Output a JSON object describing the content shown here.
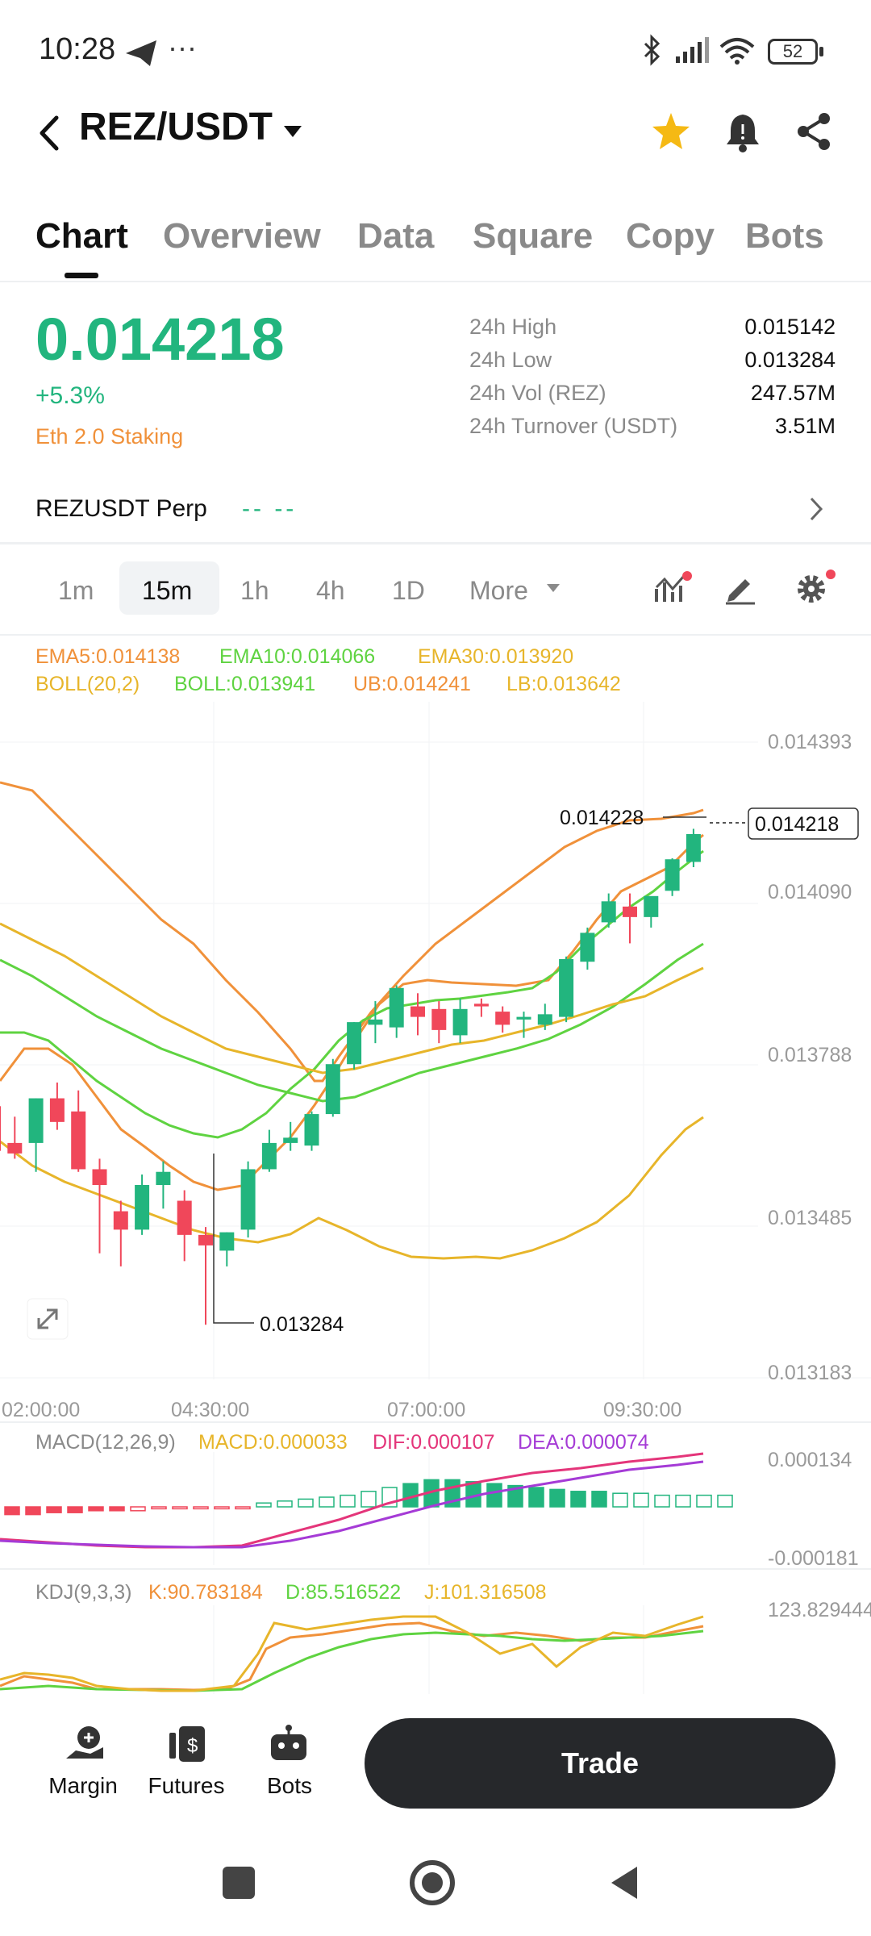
{
  "status": {
    "time": "10:28",
    "battery": "52"
  },
  "header": {
    "pair": "REZ/USDT"
  },
  "tabs": [
    {
      "label": "Chart"
    },
    {
      "label": "Overview"
    },
    {
      "label": "Data"
    },
    {
      "label": "Square"
    },
    {
      "label": "Copy"
    },
    {
      "label": "Bots"
    }
  ],
  "ticker": {
    "last_price": "0.014218",
    "change_pct": "+5.3%",
    "tag": "Eth 2.0 Staking",
    "stats": [
      {
        "label": "24h High",
        "value": "0.015142"
      },
      {
        "label": "24h Low",
        "value": "0.013284"
      },
      {
        "label": "24h Vol (REZ)",
        "value": "247.57M"
      },
      {
        "label": "24h Turnover (USDT)",
        "value": "3.51M"
      }
    ]
  },
  "perp": {
    "label": "REZUSDT Perp",
    "value": "-- --"
  },
  "intervals": [
    {
      "label": "1m"
    },
    {
      "label": "15m"
    },
    {
      "label": "1h"
    },
    {
      "label": "4h"
    },
    {
      "label": "1D"
    },
    {
      "label": "More"
    }
  ],
  "indicators": {
    "ema5": "EMA5:0.014138",
    "ema10": "EMA10:0.014066",
    "ema30": "EMA30:0.013920",
    "boll_name": "BOLL(20,2)",
    "boll": "BOLL:0.013941",
    "ub": "UB:0.014241",
    "lb": "LB:0.013642"
  },
  "colors": {
    "up": "#22b57e",
    "down": "#f0475a",
    "ema5": "#f0913a",
    "ema10": "#5fd341",
    "ema30": "#e7b52a"
  },
  "chart_data": {
    "type": "candlestick",
    "y_ticks": [
      "0.014393",
      "0.014090",
      "0.013788",
      "0.013485",
      "0.013183"
    ],
    "x_ticks": [
      "02:00:00",
      "04:30:00",
      "07:00:00",
      "09:30:00"
    ],
    "current_price_label": "0.014218",
    "high_marker": "0.014228",
    "low_marker": "0.013284",
    "candles": [
      {
        "o": 0.0137,
        "h": 0.013735,
        "l": 0.013595,
        "c": 0.013615
      },
      {
        "o": 0.01363,
        "h": 0.01368,
        "l": 0.0136,
        "c": 0.01361
      },
      {
        "o": 0.01363,
        "h": 0.013715,
        "l": 0.013575,
        "c": 0.013715
      },
      {
        "o": 0.013715,
        "h": 0.013745,
        "l": 0.013655,
        "c": 0.01367
      },
      {
        "o": 0.01369,
        "h": 0.01373,
        "l": 0.013575,
        "c": 0.01358
      },
      {
        "o": 0.01358,
        "h": 0.0136,
        "l": 0.01342,
        "c": 0.01355
      },
      {
        "o": 0.0135,
        "h": 0.01352,
        "l": 0.013395,
        "c": 0.013465
      },
      {
        "o": 0.013465,
        "h": 0.01357,
        "l": 0.013455,
        "c": 0.01355
      },
      {
        "o": 0.01355,
        "h": 0.013595,
        "l": 0.013505,
        "c": 0.013575
      },
      {
        "o": 0.01352,
        "h": 0.01354,
        "l": 0.013405,
        "c": 0.013455
      },
      {
        "o": 0.013455,
        "h": 0.01347,
        "l": 0.013284,
        "c": 0.013435
      },
      {
        "o": 0.013425,
        "h": 0.01346,
        "l": 0.013395,
        "c": 0.01346
      },
      {
        "o": 0.013465,
        "h": 0.013595,
        "l": 0.01345,
        "c": 0.01358
      },
      {
        "o": 0.01358,
        "h": 0.013655,
        "l": 0.013575,
        "c": 0.01363
      },
      {
        "o": 0.01363,
        "h": 0.01367,
        "l": 0.013615,
        "c": 0.01364
      },
      {
        "o": 0.013625,
        "h": 0.01369,
        "l": 0.013615,
        "c": 0.013685
      },
      {
        "o": 0.013685,
        "h": 0.01379,
        "l": 0.01368,
        "c": 0.01378
      },
      {
        "o": 0.01378,
        "h": 0.01386,
        "l": 0.01377,
        "c": 0.01386
      },
      {
        "o": 0.013855,
        "h": 0.0139,
        "l": 0.01382,
        "c": 0.013865
      },
      {
        "o": 0.01385,
        "h": 0.01393,
        "l": 0.01383,
        "c": 0.013925
      },
      {
        "o": 0.01389,
        "h": 0.013915,
        "l": 0.013835,
        "c": 0.01387
      },
      {
        "o": 0.013885,
        "h": 0.0139,
        "l": 0.01382,
        "c": 0.013845
      },
      {
        "o": 0.013835,
        "h": 0.013905,
        "l": 0.01382,
        "c": 0.013885
      },
      {
        "o": 0.013895,
        "h": 0.013905,
        "l": 0.01387,
        "c": 0.01389
      },
      {
        "o": 0.01388,
        "h": 0.01389,
        "l": 0.01384,
        "c": 0.013855
      },
      {
        "o": 0.013865,
        "h": 0.01388,
        "l": 0.01383,
        "c": 0.01387
      },
      {
        "o": 0.013855,
        "h": 0.013895,
        "l": 0.013845,
        "c": 0.013875
      },
      {
        "o": 0.01387,
        "h": 0.013985,
        "l": 0.01386,
        "c": 0.01398
      },
      {
        "o": 0.013975,
        "h": 0.01404,
        "l": 0.01396,
        "c": 0.01403
      },
      {
        "o": 0.01405,
        "h": 0.014105,
        "l": 0.01404,
        "c": 0.01409
      },
      {
        "o": 0.01408,
        "h": 0.014105,
        "l": 0.01401,
        "c": 0.01406
      },
      {
        "o": 0.01406,
        "h": 0.014095,
        "l": 0.01404,
        "c": 0.0141
      },
      {
        "o": 0.01411,
        "h": 0.014172,
        "l": 0.0141,
        "c": 0.01417
      },
      {
        "o": 0.014165,
        "h": 0.014228,
        "l": 0.014155,
        "c": 0.014218
      }
    ]
  },
  "macd": {
    "name": "MACD(12,26,9)",
    "macd": "MACD:0.000033",
    "dif": "DIF:0.000107",
    "dea": "DEA:0.000074",
    "top": "0.000134",
    "bottom": "-0.000181"
  },
  "kdj": {
    "name": "KDJ(9,3,3)",
    "k": "K:90.783184",
    "d": "D:85.516522",
    "j": "J:101.316508",
    "top": "123.829444"
  },
  "bottom_nav": [
    {
      "label": "Margin"
    },
    {
      "label": "Futures"
    },
    {
      "label": "Bots"
    }
  ],
  "trade_button": "Trade"
}
